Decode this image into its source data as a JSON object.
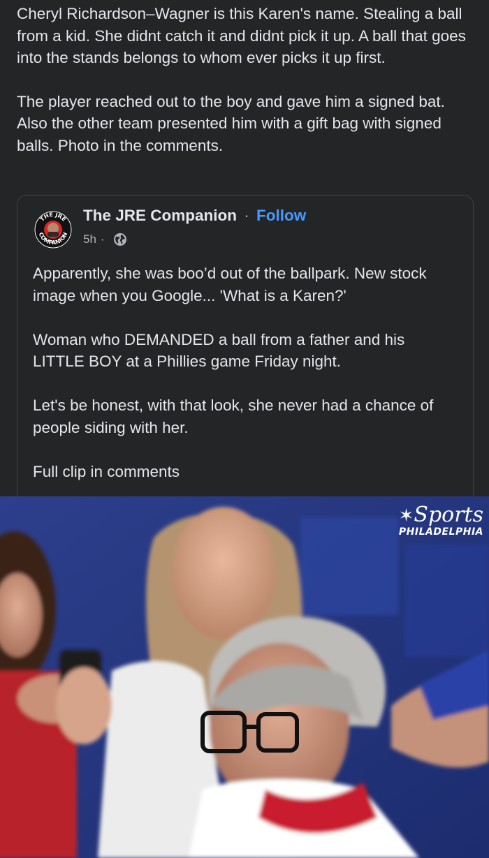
{
  "post": {
    "paragraphs": [
      "Cheryl Richardson–Wagner is this Karen's name. Stealing a ball from a kid. She didnt catch it and didnt pick it up. A ball that goes into the stands belongs to whom ever picks it up first.",
      "The player reached out to the boy and gave him a signed bat. Also the other team presented him with a gift bag with signed balls. Photo in the comments."
    ]
  },
  "shared_post": {
    "author": "The JRE Companion",
    "separator": "·",
    "follow_label": "Follow",
    "time": "5h",
    "time_separator": "·",
    "avatar_text_top": "THE JRE",
    "avatar_text_bottom": "COMPANION",
    "paragraphs": [
      "Apparently, she was boo’d out of the ballpark. New stock image when you Google... 'What is a Karen?'",
      "Woman who DEMANDED a ball from a father and his LITTLE BOY at a Phillies game Friday night.",
      "Let's be honest, with that look, she never had a chance of people siding with her.",
      "Full clip in comments"
    ]
  },
  "photo": {
    "brand_name": "Sports",
    "brand_city": "PHILADELPHIA"
  },
  "colors": {
    "background": "#242526",
    "text": "#e4e6eb",
    "secondary_text": "#b0b3b8",
    "link": "#4599ff"
  }
}
